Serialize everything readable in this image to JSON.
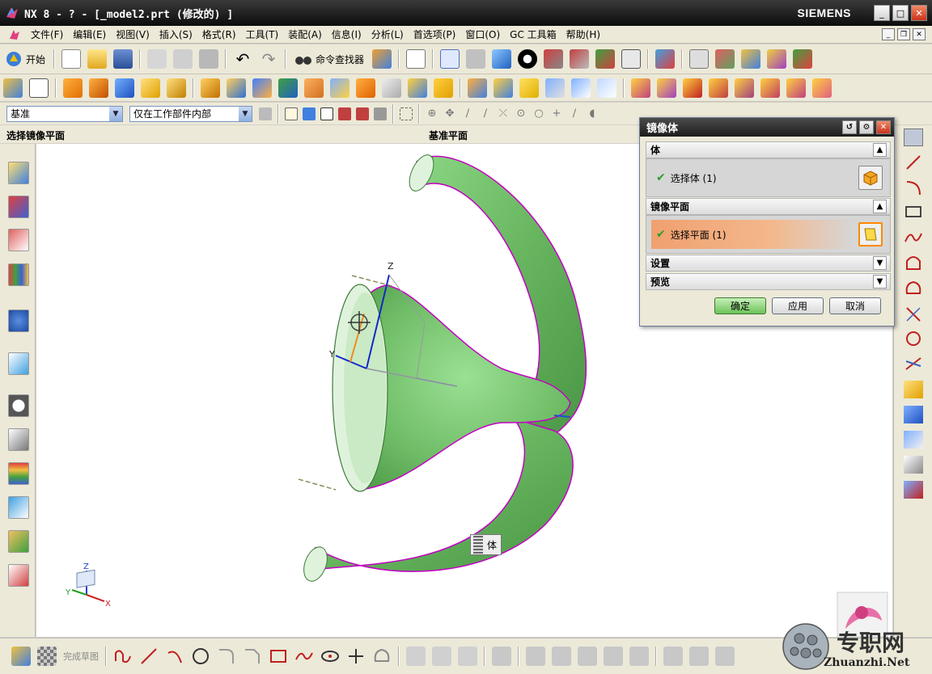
{
  "window": {
    "title": "NX 8 - ? - [_model2.prt  (修改的) ]",
    "brand": "SIEMENS",
    "minimize": "_",
    "maximize": "□",
    "close": "✕"
  },
  "menu": {
    "items": [
      "文件(F)",
      "编辑(E)",
      "视图(V)",
      "插入(S)",
      "格式(R)",
      "工具(T)",
      "装配(A)",
      "信息(I)",
      "分析(L)",
      "首选项(P)",
      "窗口(O)",
      "GC 工具箱",
      "帮助(H)"
    ]
  },
  "toolbar": {
    "start_label": "开始",
    "command_finder_label": "命令查找器"
  },
  "selection_bar": {
    "filter_value": "基准",
    "scope_value": "仅在工作部件内部"
  },
  "cue": {
    "left": "选择镜像平面",
    "right": "基准平面"
  },
  "viewport": {
    "selection_tag": "体",
    "axis_labels": {
      "z": "Z",
      "y": "Y",
      "x": "X"
    },
    "triad_labels": {
      "z": "Z",
      "y": "Y",
      "x": "X"
    }
  },
  "dialog": {
    "title": "镜像体",
    "groups": {
      "body": {
        "header": "体",
        "row_label": "选择体 (1)"
      },
      "mirror_plane": {
        "header": "镜像平面",
        "row_label": "选择平面 (1)"
      },
      "settings": {
        "header": "设置"
      },
      "preview": {
        "header": "预览"
      }
    },
    "buttons": {
      "ok": "确定",
      "apply": "应用",
      "cancel": "取消"
    }
  },
  "sketch_toolbar": {
    "finish_sketch_label": "完成草图"
  },
  "watermark": {
    "brand": "专职网",
    "url": "Zhuanzhi.Net"
  },
  "colors": {
    "model_green": "#6fc068",
    "highlight_magenta": "#c400c4",
    "ok_button": "#6cc25a",
    "active_selection": "#f0a070"
  }
}
